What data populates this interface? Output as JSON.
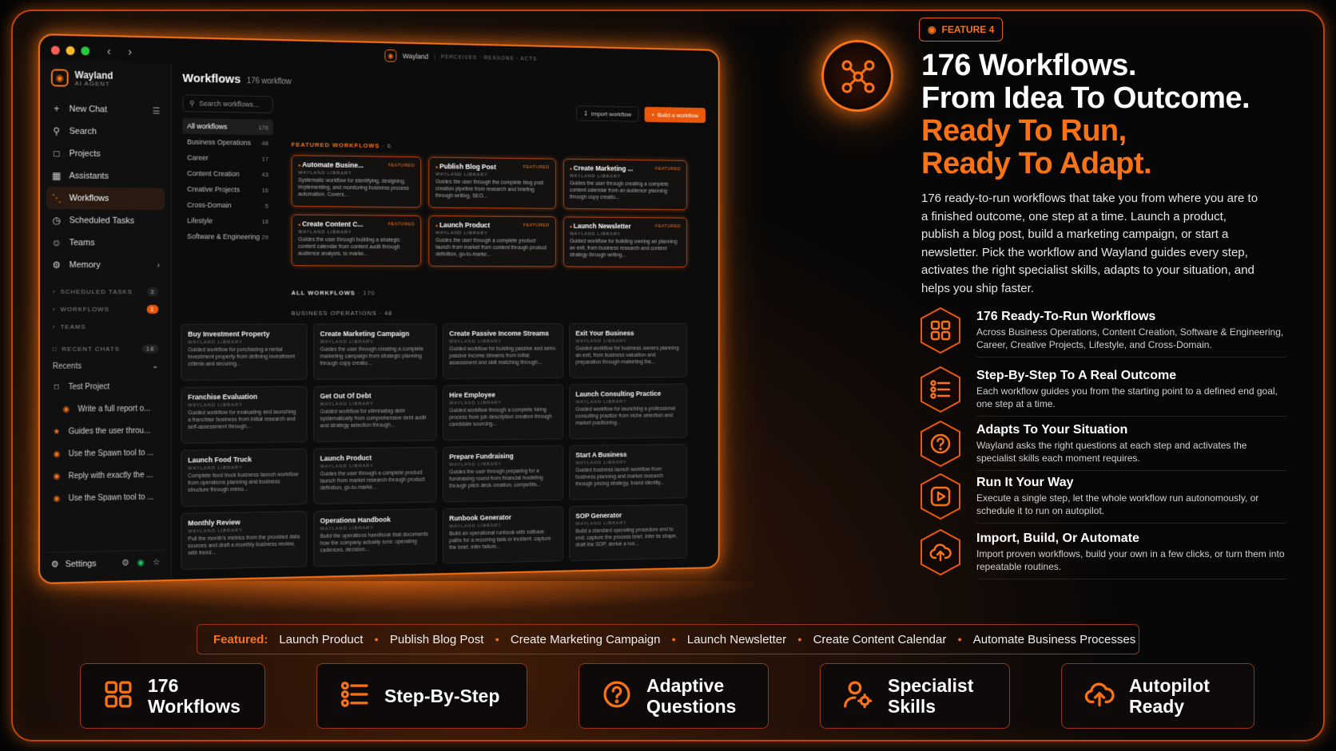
{
  "app": {
    "brand_name": "Wayland",
    "brand_sub": "AI AGENT",
    "topbar_name": "Wayland",
    "topbar_tagline": "PERCEIVES · REASONS · ACTS",
    "nav_items": [
      {
        "label": "New Chat",
        "icon": "plus-icon"
      },
      {
        "label": "Search",
        "icon": "search-icon"
      },
      {
        "label": "Projects",
        "icon": "folder-icon"
      },
      {
        "label": "Assistants",
        "icon": "grid-icon"
      },
      {
        "label": "Workflows",
        "icon": "workflow-icon"
      },
      {
        "label": "Scheduled Tasks",
        "icon": "clock-icon"
      },
      {
        "label": "Teams",
        "icon": "users-icon"
      },
      {
        "label": "Memory",
        "icon": "memory-icon"
      }
    ],
    "sections": [
      {
        "label": "SCHEDULED TASKS",
        "count": "3"
      },
      {
        "label": "WORKFLOWS",
        "count": "1"
      },
      {
        "label": "TEAMS",
        "count": ""
      }
    ],
    "recent_chats_label": "RECENT CHATS",
    "recent_chats_count": "18",
    "recents_label": "Recents",
    "recents": [
      "Test Project",
      "Write a full report o...",
      "Guides the user throu...",
      "Use the Spawn tool to ...",
      "Reply with exactly the ...",
      "Use the Spawn tool to ..."
    ],
    "settings_label": "Settings",
    "workflows_title": "Workflows",
    "workflows_count": "176 workflow",
    "search_placeholder": "Search workflows...",
    "categories": [
      {
        "name": "All workflows",
        "count": "176"
      },
      {
        "name": "Business Operations",
        "count": "48"
      },
      {
        "name": "Career",
        "count": "17"
      },
      {
        "name": "Content Creation",
        "count": "43"
      },
      {
        "name": "Creative Projects",
        "count": "16"
      },
      {
        "name": "Cross-Domain",
        "count": "5"
      },
      {
        "name": "Lifestyle",
        "count": "18"
      },
      {
        "name": "Software & Engineering",
        "count": "29"
      }
    ],
    "import_label": "Import workflow",
    "build_label": "Build a workflow",
    "featured_label": "FEATURED WORKFLOWS",
    "featured_count": "· 6",
    "featured_tag": "FEATURED",
    "library_label": "WAYLAND LIBRARY",
    "featured": [
      {
        "name": "Automate Busine...",
        "desc": "Systematic workflow for identifying, designing, implementing, and monitoring business process automation. Covers..."
      },
      {
        "name": "Publish Blog Post",
        "desc": "Guides the user through the complete blog post creation pipeline from research and briefing through writing, SEO..."
      },
      {
        "name": "Create Marketing ...",
        "desc": "Guides the user through creating a complete content calendar from an audience planning through copy creatio..."
      },
      {
        "name": "Create Content C...",
        "desc": "Guides the user through building a strategic content calendar from content audit through audience analysis, to marke..."
      },
      {
        "name": "Launch Product",
        "desc": "Guides the user through a complete product launch from market from content through product definition, go-to-marke..."
      },
      {
        "name": "Launch Newsletter",
        "desc": "Guided workflow for building owning an planning an exit, from business research and content strategy through writing..."
      }
    ],
    "all_label": "ALL WORKFLOWS",
    "all_count": "· 170",
    "biz_label": "BUSINESS OPERATIONS",
    "biz_count": "· 48",
    "workflows": [
      {
        "name": "Buy Investment Property",
        "desc": "Guided workflow for purchasing a rental investment property from defining investment criteria and securing..."
      },
      {
        "name": "Create Marketing Campaign",
        "desc": "Guides the user through creating a complete marketing campaign from strategic planning through copy creatio..."
      },
      {
        "name": "Create Passive Income Streams",
        "desc": "Guided workflow for building passive and semi-passive income streams from initial assessment and skill matching through..."
      },
      {
        "name": "Exit Your Business",
        "desc": "Guided workflow for business owners planning an exit, from business valuation and preparation through marketing the..."
      },
      {
        "name": "Franchise Evaluation",
        "desc": "Guided workflow for evaluating and launching a franchise business from initial research and self-assessment through..."
      },
      {
        "name": "Get Out Of Debt",
        "desc": "Guided workflow for eliminating debt systematically from comprehensive debt audit and strategy selection through..."
      },
      {
        "name": "Hire Employee",
        "desc": "Guided workflow through a complete hiring process from job description creation through candidate sourcing..."
      },
      {
        "name": "Launch Consulting Practice",
        "desc": "Guided workflow for launching a professional consulting practice from niche selection and market positioning..."
      },
      {
        "name": "Launch Food Truck",
        "desc": "Complete food truck business launch workflow from operations planning and business structure through menu..."
      },
      {
        "name": "Launch Product",
        "desc": "Guides the user through a complete product launch from market research through product definition, go-to-marke..."
      },
      {
        "name": "Prepare Fundraising",
        "desc": "Guides the user through preparing for a fundraising round from financial modeling through pitch deck creation, competitiv..."
      },
      {
        "name": "Start A Business",
        "desc": "Guided business launch workflow from business planning and market research through pricing strategy, brand identity..."
      },
      {
        "name": "Monthly Review",
        "desc": "Pull the month's metrics from the provided data sources and draft a monthly business review, with trend..."
      },
      {
        "name": "Operations Handbook",
        "desc": "Build the operations handbook that documents how the company actually runs: operating cadences, decision..."
      },
      {
        "name": "Runbook Generator",
        "desc": "Build an operational runbook with rollback paths for a recurring task or incident: capture the brief, infer failure..."
      },
      {
        "name": "SOP Generator",
        "desc": "Build a standard operating procedure end to end: capture the process brief, infer its shape, draft the SOP, derive a run..."
      }
    ]
  },
  "panel": {
    "badge": "FEATURE 4",
    "headline_white_1": "176 Workflows.",
    "headline_white_2": "From Idea To Outcome.",
    "headline_orange_1": "Ready To Run,",
    "headline_orange_2": "Ready To Adapt.",
    "lede": "176 ready-to-run workflows that take you from where you are to a finished outcome, one step at a time. Launch a product, publish a blog post, build a marketing campaign, or start a newsletter. Pick the workflow and Wayland guides every step, activates the right specialist skills, adapts to your situation, and helps you ship faster.",
    "features": [
      {
        "title": "176 Ready-To-Run Workflows",
        "desc": "Across Business Operations, Content Creation, Software & Engineering, Career, Creative Projects, Lifestyle, and Cross-Domain.",
        "icon": "grid-icon"
      },
      {
        "title": "Step-By-Step To A Real Outcome",
        "desc": "Each workflow guides you from the starting point to a defined end goal, one step at a time.",
        "icon": "list-icon"
      },
      {
        "title": "Adapts To Your Situation",
        "desc": "Wayland asks the right questions at each step and activates the specialist skills each moment requires.",
        "icon": "question-icon"
      },
      {
        "title": "Run It Your Way",
        "desc": "Execute a single step, let the whole workflow run autonomously, or schedule it to run on autopilot.",
        "icon": "play-icon"
      },
      {
        "title": "Import, Build, Or Automate",
        "desc": "Import proven workflows, build your own in a few clicks, or turn them into repeatable routines.",
        "icon": "upload-cloud-icon"
      }
    ],
    "featured_strip_label": "Featured:",
    "featured_strip": [
      "Launch Product",
      "Publish Blog Post",
      "Create Marketing Campaign",
      "Launch Newsletter",
      "Create Content Calendar",
      "Automate Business Processes"
    ],
    "bottom": [
      {
        "label": "176\nWorkflows",
        "icon": "grid-icon"
      },
      {
        "label": "Step-By-Step",
        "icon": "list-icon"
      },
      {
        "label": "Adaptive\nQuestions",
        "icon": "question-icon"
      },
      {
        "label": "Specialist\nSkills",
        "icon": "user-gear-icon"
      },
      {
        "label": "Autopilot\nReady",
        "icon": "upload-cloud-icon"
      }
    ]
  },
  "colors": {
    "accent": "#f97316",
    "accent_dark": "#c2410c",
    "bg": "#050505"
  }
}
